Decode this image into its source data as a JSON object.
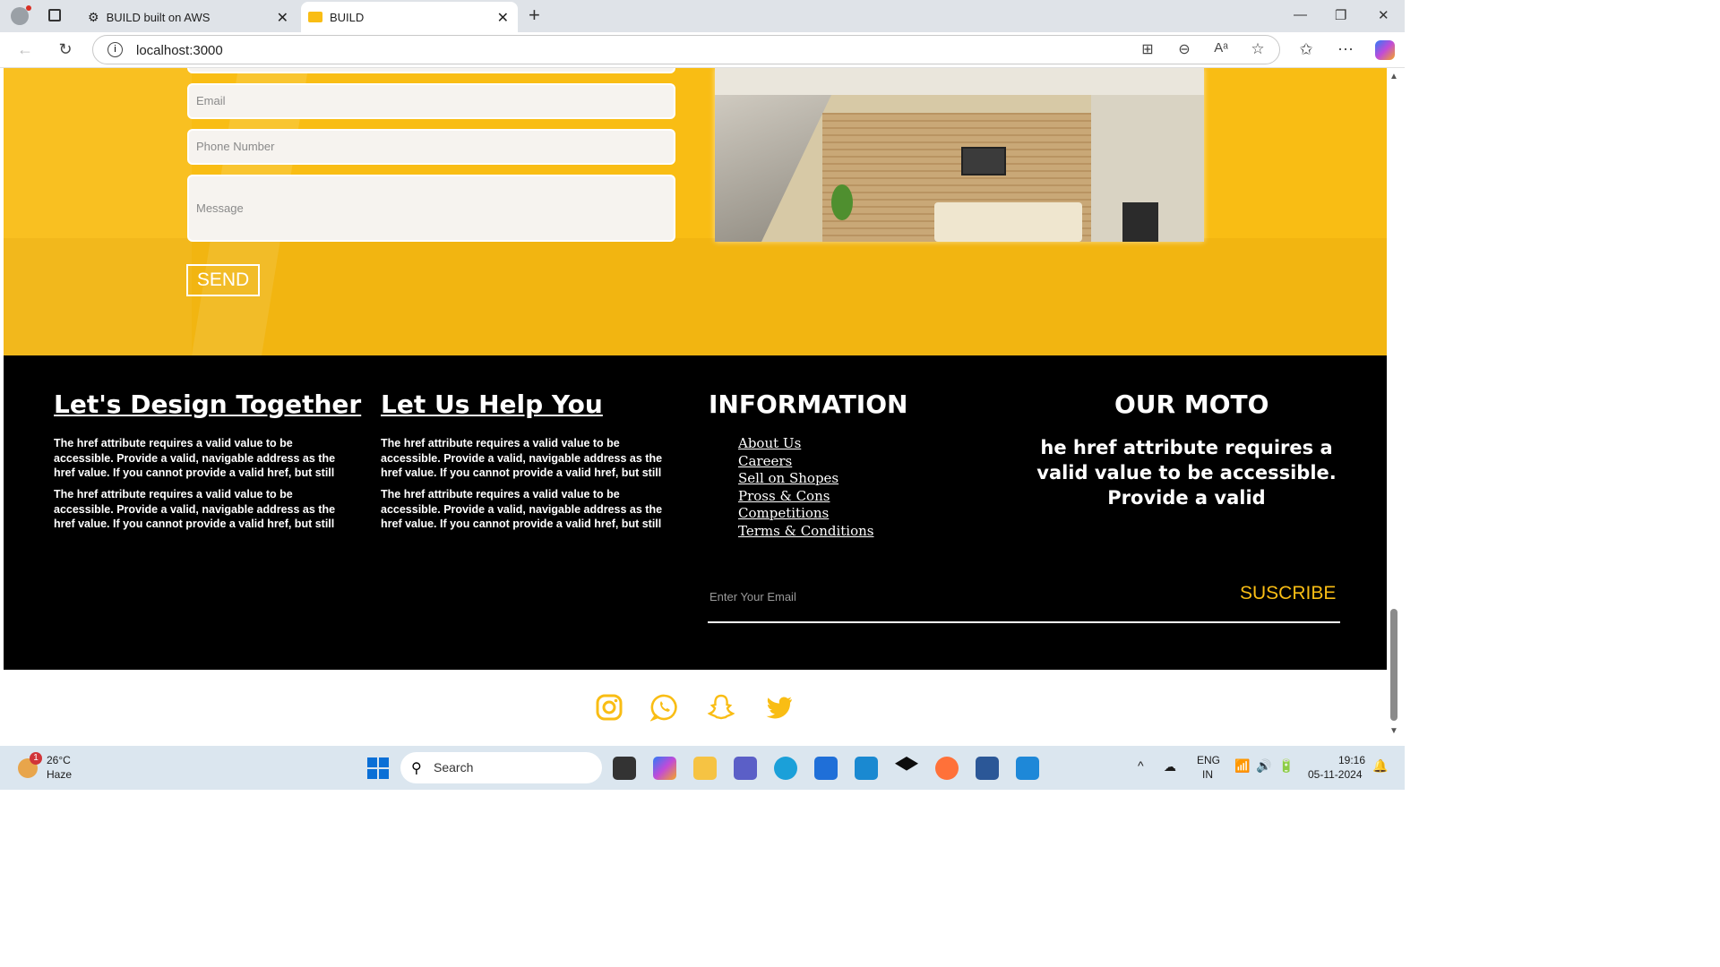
{
  "browser": {
    "tabs": [
      {
        "title": "BUILD built on AWS"
      },
      {
        "title": "BUILD"
      }
    ],
    "url": "localhost:3000"
  },
  "contact_form": {
    "email_placeholder": "Email",
    "phone_placeholder": "Phone Number",
    "message_placeholder": "Message",
    "send_label": "SEND"
  },
  "footer": {
    "col1": {
      "heading": "Let's Design Together",
      "paragraphs": [
        "The href attribute requires a valid value to be accessible. Provide a valid, navigable address as the href value. If you cannot provide a valid href, but still",
        "The href attribute requires a valid value to be accessible. Provide a valid, navigable address as the href value. If you cannot provide a valid href, but still"
      ]
    },
    "col2": {
      "heading": "Let Us Help You",
      "paragraphs": [
        "The href attribute requires a valid value to be accessible. Provide a valid, navigable address as the href value. If you cannot provide a valid href, but still",
        "The href attribute requires a valid value to be accessible. Provide a valid, navigable address as the href value. If you cannot provide a valid href, but still"
      ]
    },
    "info": {
      "heading": "INFORMATION",
      "links": [
        "About Us",
        "Careers",
        "Sell on Shopes",
        "Pross & Cons",
        "Competitions",
        "Terms & Conditions"
      ]
    },
    "moto": {
      "heading": "OUR MOTO",
      "text": "he href attribute requires a valid value to be accessible. Provide a valid"
    },
    "subscribe": {
      "email_placeholder": "Enter Your Email",
      "button_label": "SUSCRIBE"
    }
  },
  "social_icons": [
    "instagram-icon",
    "whatsapp-icon",
    "snapchat-icon",
    "twitter-icon"
  ],
  "colors": {
    "accent": "#f9bd14",
    "footer_bg": "#000000"
  },
  "taskbar": {
    "weather_temp": "26°C",
    "weather_desc": "Haze",
    "weather_badge": "1",
    "search_label": "Search",
    "lang": "ENG",
    "region": "IN",
    "time": "19:16",
    "date": "05-11-2024"
  }
}
